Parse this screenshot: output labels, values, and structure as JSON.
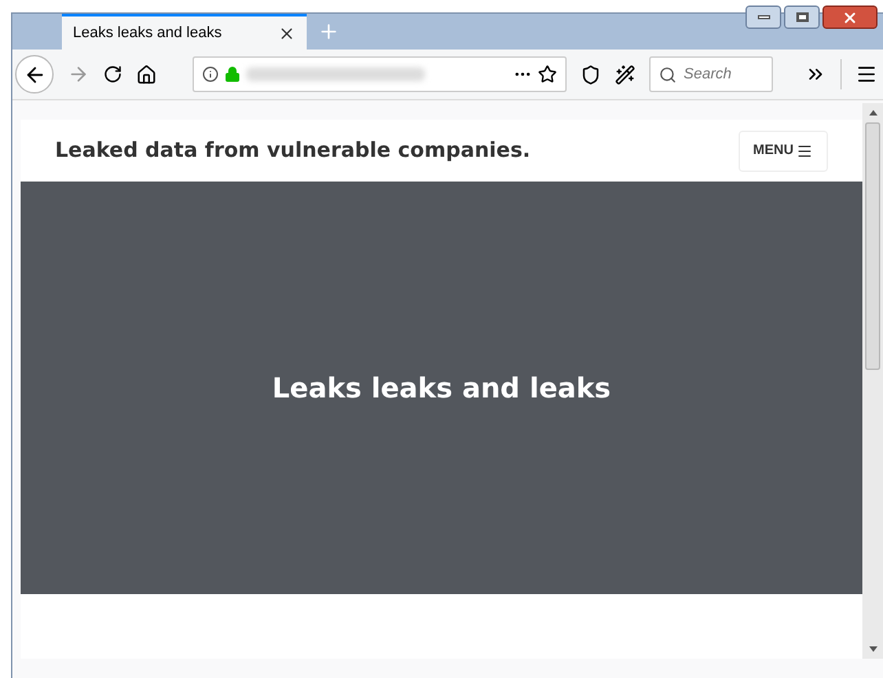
{
  "tabs": [
    {
      "label": "Leaks leaks and leaks",
      "selected": true
    }
  ],
  "toolbar": {
    "search": {
      "placeholder": "Search"
    }
  },
  "page": {
    "site_title": "Leaked data from vulnerable companies.",
    "menu_button": "MENU",
    "hero_title": "Leaks leaks and leaks"
  }
}
